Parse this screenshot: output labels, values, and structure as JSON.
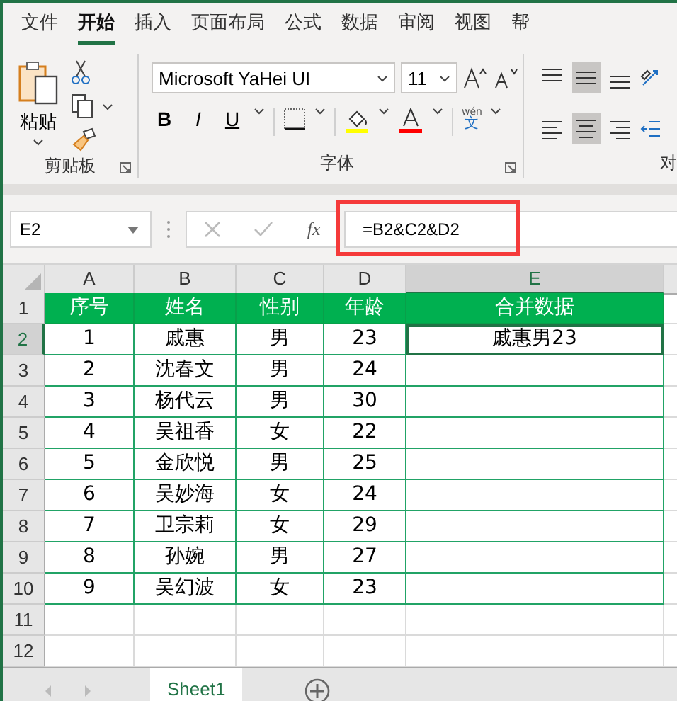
{
  "ribbon_tabs": [
    {
      "label": "文件",
      "selected": false
    },
    {
      "label": "开始",
      "selected": true
    },
    {
      "label": "插入",
      "selected": false
    },
    {
      "label": "页面布局",
      "selected": false
    },
    {
      "label": "公式",
      "selected": false
    },
    {
      "label": "数据",
      "selected": false
    },
    {
      "label": "审阅",
      "selected": false
    },
    {
      "label": "视图",
      "selected": false
    },
    {
      "label": "帮",
      "selected": false
    }
  ],
  "clipboard": {
    "paste_label": "粘贴",
    "group_label": "剪贴板"
  },
  "font": {
    "name": "Microsoft YaHei UI",
    "size": "11",
    "bold": "B",
    "italic": "I",
    "underline": "U",
    "phonetic_top": "wén",
    "phonetic_bottom": "文",
    "group_label": "字体"
  },
  "alignment": {
    "group_label": "对"
  },
  "formula_bar": {
    "name_box": "E2",
    "fx_label": "fx",
    "formula": "=B2&C2&D2",
    "highlighted": true
  },
  "sheet": {
    "columns": [
      {
        "label": "A",
        "selected": false
      },
      {
        "label": "B",
        "selected": false
      },
      {
        "label": "C",
        "selected": false
      },
      {
        "label": "D",
        "selected": false
      },
      {
        "label": "E",
        "selected": true
      }
    ],
    "rows": [
      {
        "number": "1",
        "kind": "header",
        "selected": false,
        "cells": [
          "序号",
          "姓名",
          "性别",
          "年龄",
          "合并数据"
        ]
      },
      {
        "number": "2",
        "kind": "data",
        "selected": true,
        "cells": [
          "1",
          "戚惠",
          "男",
          "23",
          "戚惠男23"
        ]
      },
      {
        "number": "3",
        "kind": "data",
        "selected": false,
        "cells": [
          "2",
          "沈春文",
          "男",
          "24",
          ""
        ]
      },
      {
        "number": "4",
        "kind": "data",
        "selected": false,
        "cells": [
          "3",
          "杨代云",
          "男",
          "30",
          ""
        ]
      },
      {
        "number": "5",
        "kind": "data",
        "selected": false,
        "cells": [
          "4",
          "吴祖香",
          "女",
          "22",
          ""
        ]
      },
      {
        "number": "6",
        "kind": "data",
        "selected": false,
        "cells": [
          "5",
          "金欣悦",
          "男",
          "25",
          ""
        ]
      },
      {
        "number": "7",
        "kind": "data",
        "selected": false,
        "cells": [
          "6",
          "吴妙海",
          "女",
          "24",
          ""
        ]
      },
      {
        "number": "8",
        "kind": "data",
        "selected": false,
        "cells": [
          "7",
          "卫宗莉",
          "女",
          "29",
          ""
        ]
      },
      {
        "number": "9",
        "kind": "data",
        "selected": false,
        "cells": [
          "8",
          "孙婉",
          "男",
          "27",
          ""
        ]
      },
      {
        "number": "10",
        "kind": "data",
        "selected": false,
        "cells": [
          "9",
          "吴幻波",
          "女",
          "23",
          ""
        ]
      },
      {
        "number": "11",
        "kind": "empty",
        "selected": false,
        "cells": []
      },
      {
        "number": "12",
        "kind": "empty",
        "selected": false,
        "cells": []
      }
    ]
  },
  "sheet_tabs": [
    {
      "label": "Sheet1",
      "selected": true
    }
  ]
}
